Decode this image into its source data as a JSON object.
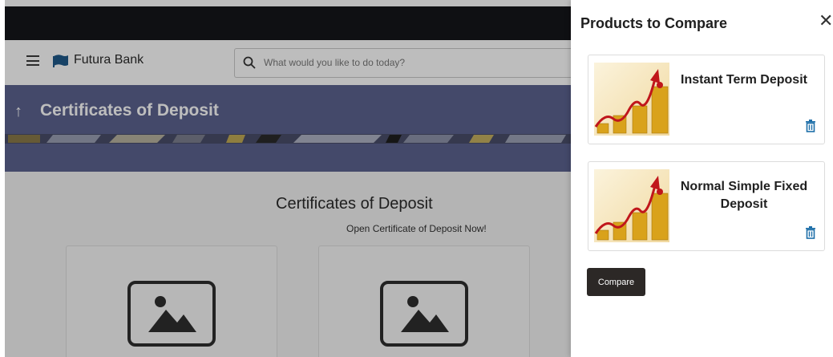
{
  "header": {
    "brand": "Futura Bank",
    "search_placeholder": "What would you like to do today?"
  },
  "banner": {
    "back_arrow": "↑",
    "title": "Certificates of Deposit"
  },
  "main": {
    "section_title": "Certificates of Deposit",
    "section_subtitle": "Open Certificate of Deposit Now!"
  },
  "compare_panel": {
    "title": "Products to Compare",
    "close_label": "✕",
    "products": [
      {
        "name": "Instant Term Deposit"
      },
      {
        "name": "Normal Simple Fixed Deposit"
      }
    ],
    "compare_label": "Compare"
  },
  "colors": {
    "banner": "#5c6390",
    "dark_bar": "#15161a",
    "accent_trash": "#1d6ea8",
    "compare_button": "#2c2826"
  },
  "icons": {
    "menu": "hamburger-menu-icon",
    "logo": "futura-bank-logo",
    "search": "search-icon",
    "close": "close-icon",
    "delete": "trash-icon",
    "placeholder": "image-placeholder-icon"
  }
}
